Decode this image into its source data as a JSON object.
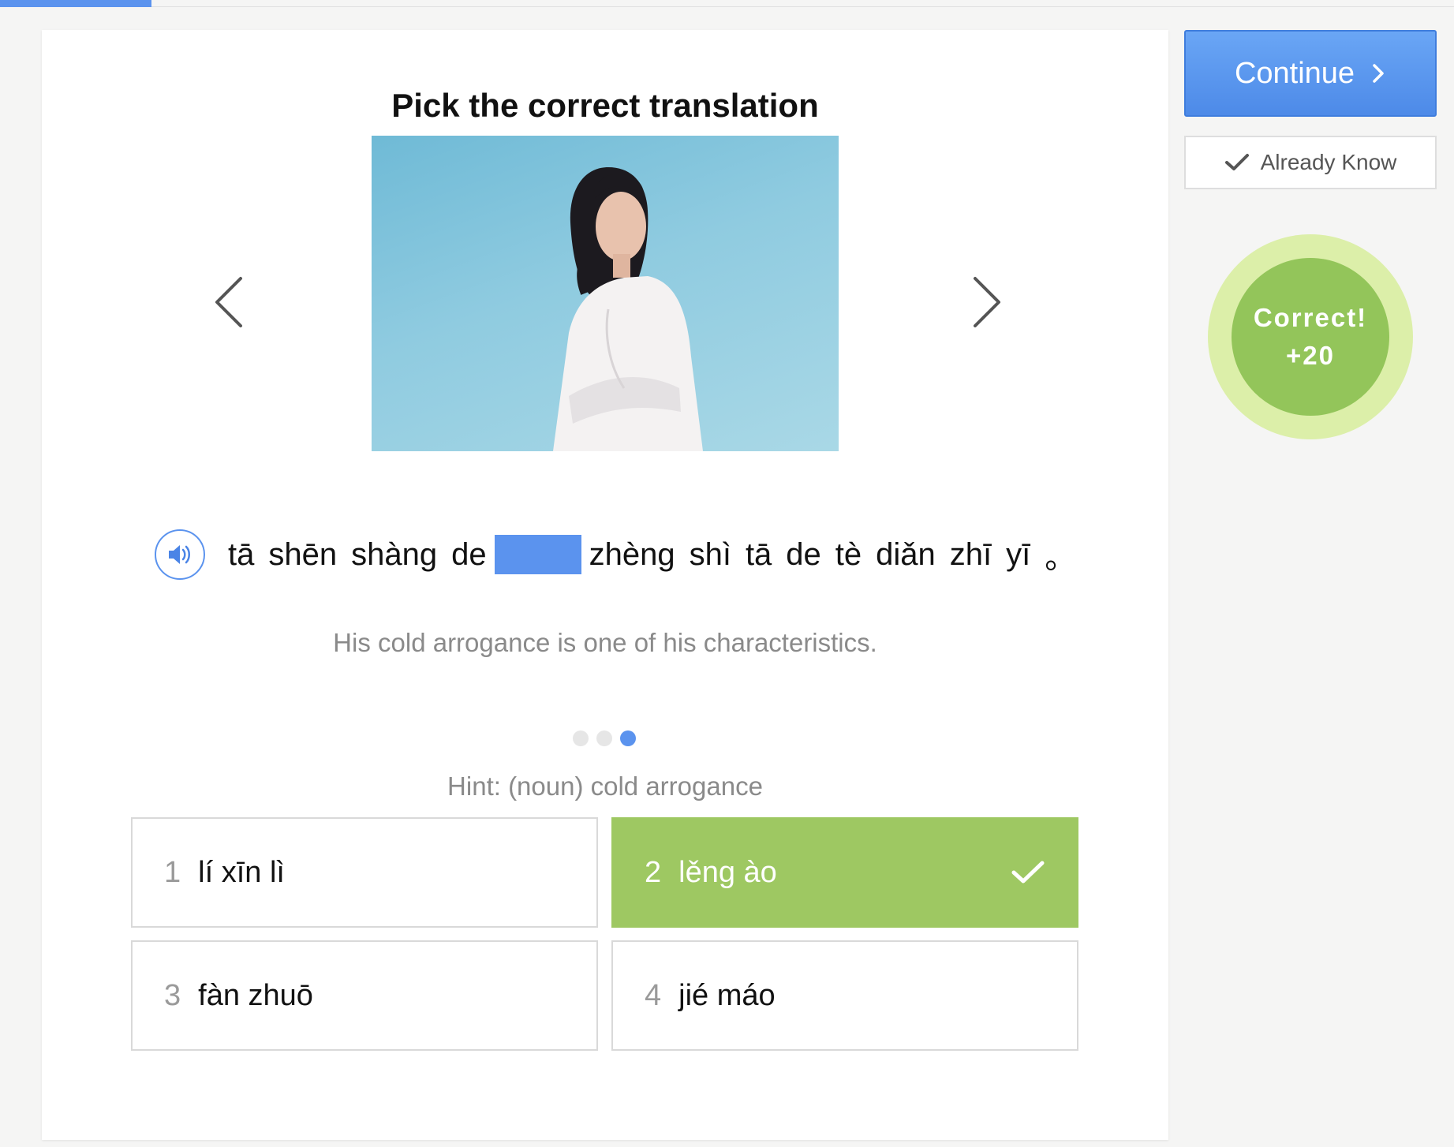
{
  "progress": {
    "fraction": 0.104
  },
  "exercise": {
    "title": "Pick the correct translation",
    "sentence_words": [
      "tā",
      "shēn",
      "shàng",
      "de",
      "zhèng",
      "shì",
      "tā",
      "de",
      "tè",
      "diǎn",
      "zhī",
      "yī",
      "。"
    ],
    "translation": "His cold arrogance is one of his characteristics.",
    "hint": "Hint: (noun) cold arrogance"
  },
  "pager": {
    "count": 3,
    "active_index": 2
  },
  "options": [
    {
      "number": "1",
      "text": "lí xīn lì",
      "state": "default"
    },
    {
      "number": "2",
      "text": "lěng ào",
      "state": "correct"
    },
    {
      "number": "3",
      "text": "fàn zhuō",
      "state": "default"
    },
    {
      "number": "4",
      "text": "jié máo",
      "state": "default"
    }
  ],
  "sidebar": {
    "continue_label": "Continue",
    "already_know_label": "Already Know",
    "feedback_title": "Correct!",
    "feedback_points": "+20"
  },
  "icons": {
    "prev": "chevron-left-icon",
    "next": "chevron-right-icon",
    "audio": "speaker-icon",
    "check": "checkmark-icon"
  },
  "colors": {
    "accent_blue": "#5b93ee",
    "correct_green": "#9ec862",
    "feedback_ring": "#dcefa9",
    "feedback_core": "#93c55a"
  }
}
